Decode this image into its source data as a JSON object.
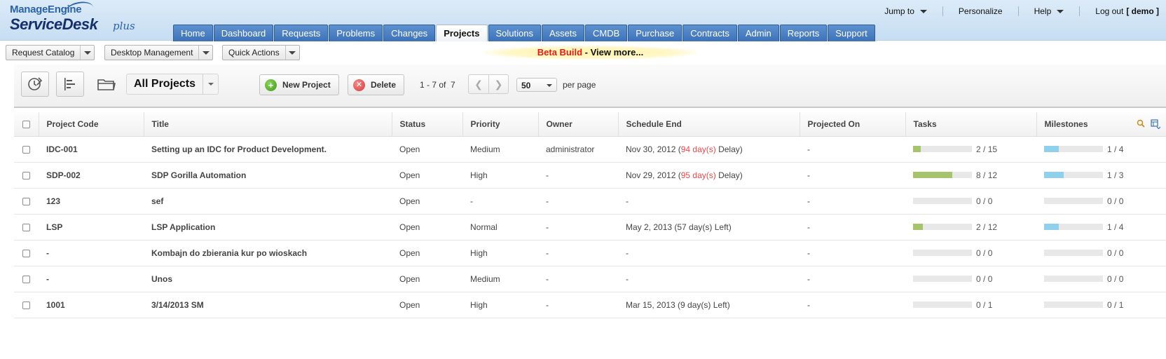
{
  "logo": {
    "manageengine": "ManageEngine",
    "servicedesk": "ServiceDesk",
    "plus": "plus"
  },
  "topnav": {
    "jump_to": "Jump to",
    "personalize": "Personalize",
    "help": "Help",
    "logout": "Log out",
    "user": "[ demo ]"
  },
  "tabs": [
    "Home",
    "Dashboard",
    "Requests",
    "Problems",
    "Changes",
    "Projects",
    "Solutions",
    "Assets",
    "CMDB",
    "Purchase",
    "Contracts",
    "Admin",
    "Reports",
    "Support"
  ],
  "active_tab": "Projects",
  "subbar": {
    "request_catalog": "Request Catalog",
    "desktop_management": "Desktop Management",
    "quick_actions": "Quick Actions",
    "beta_red": "Beta Build",
    "beta_rest": " - View more..."
  },
  "toolbar": {
    "view_name": "All Projects",
    "new_project": "New Project",
    "delete": "Delete",
    "range": "1 - 7 of",
    "total": "7",
    "per_page_value": "50",
    "per_page_label": "per page"
  },
  "table": {
    "headers": [
      "Project Code",
      "Title",
      "Status",
      "Priority",
      "Owner",
      "Schedule End",
      "Projected On",
      "Tasks",
      "Milestones"
    ],
    "rows": [
      {
        "code": "IDC-001",
        "title": "Setting up an IDC for Product Development.",
        "status": "Open",
        "priority": "Medium",
        "owner": "administrator",
        "sched_date": "Nov 30, 2012 (",
        "sched_days": "94 day(s)",
        "sched_suffix": "Delay)",
        "delay": true,
        "projected": "-",
        "tasks_done": "2",
        "tasks_total": "15",
        "tasks_frac": 0.13,
        "ms_done": "1",
        "ms_total": "4",
        "ms_frac": 0.25
      },
      {
        "code": "SDP-002",
        "title": "SDP Gorilla Automation",
        "status": "Open",
        "priority": "High",
        "owner": "-",
        "sched_date": "Nov 29, 2012 (",
        "sched_days": "95 day(s)",
        "sched_suffix": "Delay)",
        "delay": true,
        "projected": "-",
        "tasks_done": "8",
        "tasks_total": "12",
        "tasks_frac": 0.67,
        "ms_done": "1",
        "ms_total": "3",
        "ms_frac": 0.33
      },
      {
        "code": "123",
        "title": "sef",
        "status": "Open",
        "priority": "-",
        "owner": "-",
        "sched_date": "-",
        "sched_days": "",
        "sched_suffix": "",
        "delay": false,
        "projected": "-",
        "tasks_done": "0",
        "tasks_total": "0",
        "tasks_frac": 0,
        "ms_done": "0",
        "ms_total": "0",
        "ms_frac": 0
      },
      {
        "code": "LSP",
        "title": "LSP Application",
        "status": "Open",
        "priority": "Normal",
        "owner": "-",
        "sched_date": "May 2, 2013 (",
        "sched_days": "57 day(s)",
        "sched_suffix": "Left)",
        "delay": false,
        "projected": "-",
        "tasks_done": "2",
        "tasks_total": "12",
        "tasks_frac": 0.17,
        "ms_done": "1",
        "ms_total": "4",
        "ms_frac": 0.25
      },
      {
        "code": "-",
        "title": "Kombajn do zbierania kur po wioskach",
        "status": "Open",
        "priority": "High",
        "owner": "-",
        "sched_date": "-",
        "sched_days": "",
        "sched_suffix": "",
        "delay": false,
        "projected": "-",
        "tasks_done": "0",
        "tasks_total": "0",
        "tasks_frac": 0,
        "ms_done": "0",
        "ms_total": "0",
        "ms_frac": 0
      },
      {
        "code": "-",
        "title": "Unos",
        "status": "Open",
        "priority": "Medium",
        "owner": "-",
        "sched_date": "-",
        "sched_days": "",
        "sched_suffix": "",
        "delay": false,
        "projected": "-",
        "tasks_done": "0",
        "tasks_total": "0",
        "tasks_frac": 0,
        "ms_done": "0",
        "ms_total": "0",
        "ms_frac": 0
      },
      {
        "code": "1001",
        "title": "3/14/2013 SM",
        "status": "Open",
        "priority": "High",
        "owner": "-",
        "sched_date": "Mar 15, 2013 (",
        "sched_days": "9 day(s)",
        "sched_suffix": "Left)",
        "delay": false,
        "projected": "-",
        "tasks_done": "0",
        "tasks_total": "1",
        "tasks_frac": 0,
        "ms_done": "0",
        "ms_total": "1",
        "ms_frac": 0
      }
    ]
  },
  "colors": {
    "tab_blue": "#3d72b8",
    "delay_red": "#e34a4a",
    "task_green": "#a5c46b",
    "milestone_blue": "#8fd0ec",
    "beta_red": "#e01b1b"
  }
}
